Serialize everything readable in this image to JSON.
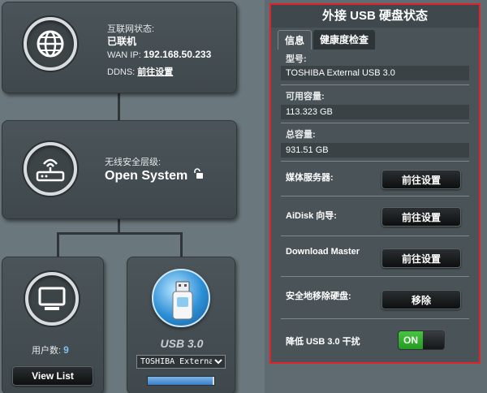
{
  "internet": {
    "status_label": "互联网状态:",
    "status_value": "已联机",
    "wan_ip_label": "WAN IP:",
    "wan_ip_value": "192.168.50.233",
    "ddns_label": "DDNS:",
    "ddns_link": "前往设置"
  },
  "wireless": {
    "security_label": "无线安全层级:",
    "security_value": "Open System"
  },
  "clients": {
    "count_label": "用户数:",
    "count_value": "9",
    "view_list_button": "View List"
  },
  "usb": {
    "device_label": "USB 3.0",
    "selected_device": "TOSHIBA External USB 3.0",
    "progress_fraction": 0.98
  },
  "panel": {
    "title": "外接 USB 硬盘状态",
    "tabs": [
      {
        "label": "信息",
        "active": true
      },
      {
        "label": "健康度检查",
        "active": false
      }
    ],
    "model_label": "型号:",
    "model_value": "TOSHIBA External USB 3.0",
    "available_label": "可用容量:",
    "available_value": "113.323 GB",
    "total_label": "总容量:",
    "total_value": "931.51 GB",
    "media_server_label": "媒体服务器:",
    "media_server_button": "前往设置",
    "aidisk_label": "AiDisk 向导:",
    "aidisk_button": "前往设置",
    "download_master_label": "Download Master",
    "download_master_button": "前往设置",
    "safe_remove_label": "安全地移除硬盘:",
    "safe_remove_button": "移除",
    "reduce_interference_label": "降低 USB 3.0 干扰",
    "reduce_interference_state": "ON"
  },
  "colors": {
    "panel_border": "#e0222a",
    "toggle_on": "#2fae2b",
    "progress_fill": "#3a7fc6"
  }
}
